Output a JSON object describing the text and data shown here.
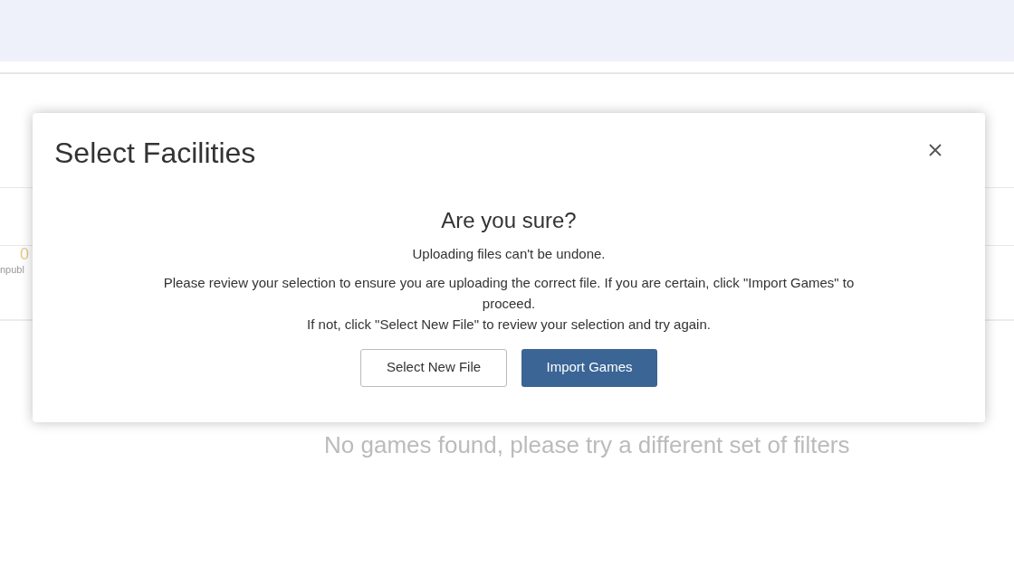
{
  "background": {
    "stat_value": "0",
    "stat_label": "npubl",
    "empty_message": "No games found, please try a different set of filters"
  },
  "modal": {
    "title": "Select Facilities",
    "heading": "Are you sure?",
    "warning": "Uploading files can't be undone.",
    "message_lines": [
      "Please review your selection to ensure you are uploading the correct file. If you are certain, click \"Import Games\" to proceed.",
      "If not, click \"Select New File\" to review your selection and try again."
    ],
    "buttons": [
      {
        "label": "Select New File",
        "kind": "secondary"
      },
      {
        "label": "Import Games",
        "kind": "primary"
      }
    ]
  }
}
